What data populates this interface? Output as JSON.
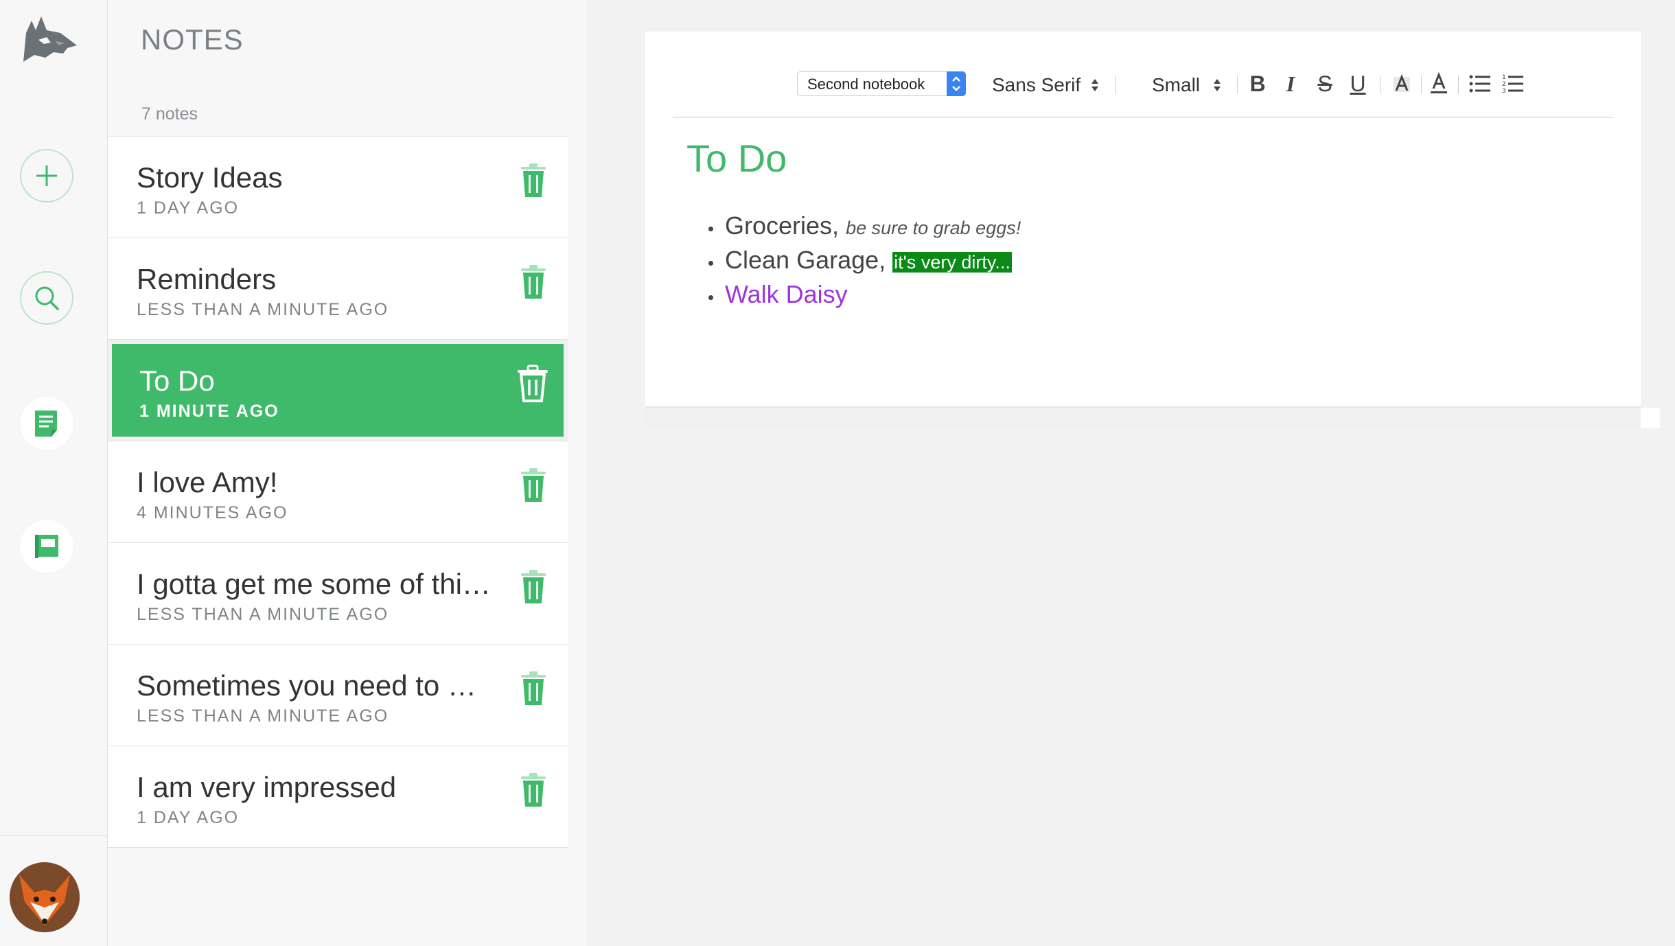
{
  "sidebar_rail": {
    "icons": [
      "wolf-logo-icon",
      "add-note-icon",
      "search-icon",
      "notes-icon",
      "notebooks-icon"
    ],
    "accent_color": "#3fba6a"
  },
  "notes_panel": {
    "header": "NOTES",
    "count_label": "7 notes",
    "notes": [
      {
        "title": "Story Ideas",
        "time": "1 DAY AGO"
      },
      {
        "title": "Reminders",
        "time": "LESS THAN A MINUTE AGO"
      },
      {
        "title": "To Do",
        "time": "1 MINUTE AGO"
      },
      {
        "title": "I love Amy!",
        "time": "4 MINUTES AGO"
      },
      {
        "title": "I gotta get me some of thi…",
        "time": "LESS THAN A MINUTE AGO"
      },
      {
        "title": "Sometimes you need to m…",
        "time": "LESS THAN A MINUTE AGO"
      },
      {
        "title": "I am very impressed",
        "time": "1 DAY AGO"
      }
    ],
    "active_index": 2
  },
  "toolbar": {
    "notebook_select": "Second notebook",
    "font_family": "Sans Serif",
    "font_size": "Small",
    "bold": "B",
    "italic": "I",
    "strike": "S",
    "underline": "U"
  },
  "document": {
    "title": "To Do",
    "items": [
      {
        "text": "Groceries,",
        "extra": "be sure to grab eggs!"
      },
      {
        "text": "Clean Garage,",
        "extra": "it's very dirty..."
      },
      {
        "text": "Walk Daisy"
      }
    ],
    "colors": {
      "title": "#3fba6a",
      "highlight": "#0c8a17",
      "purple": "#9b35e0"
    }
  }
}
